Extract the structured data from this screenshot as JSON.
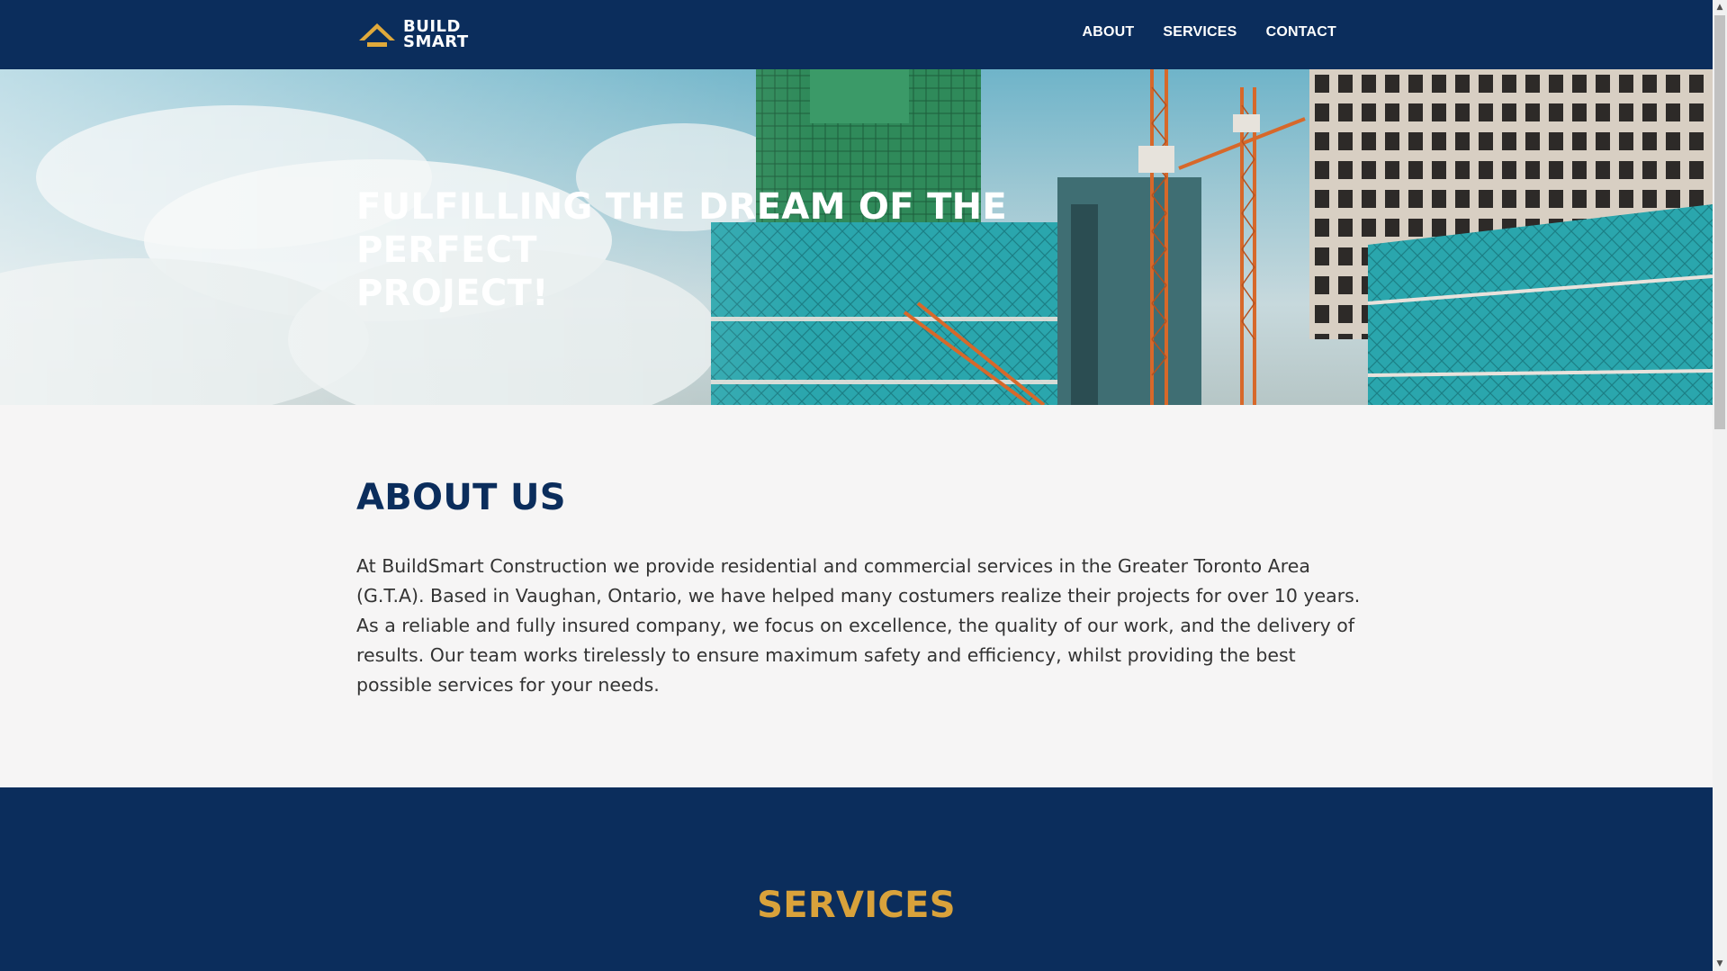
{
  "brand": {
    "line1": "BUILD",
    "line2": "SMART",
    "accent_color": "#e0a93b",
    "nav_bg": "#0b2d5c"
  },
  "nav": {
    "items": [
      {
        "label": "ABOUT"
      },
      {
        "label": "SERVICES"
      },
      {
        "label": "CONTACT"
      }
    ]
  },
  "hero": {
    "title_line1": "FULFILLING THE DREAM OF THE PERFECT",
    "title_line2": "PROJECT!"
  },
  "about": {
    "title": "ABOUT US",
    "title_color": "#0b2d5c",
    "body": "At BuildSmart Construction we provide residential and commercial services in the Greater Toronto Area (G.T.A). Based in Vaughan, Ontario, we have helped many costumers realize their projects for over 10 years. As a reliable and fully insured company, we focus on excellence, the quality of our work, and the delivery of results. Our team works tirelessly to ensure maximum safety and efficiency, whilst providing the best possible services for your needs."
  },
  "services": {
    "title": "SERVICES",
    "title_color": "#d9a23b"
  },
  "scrollbar": {
    "up_icon": "▲",
    "down_icon": "▼"
  }
}
